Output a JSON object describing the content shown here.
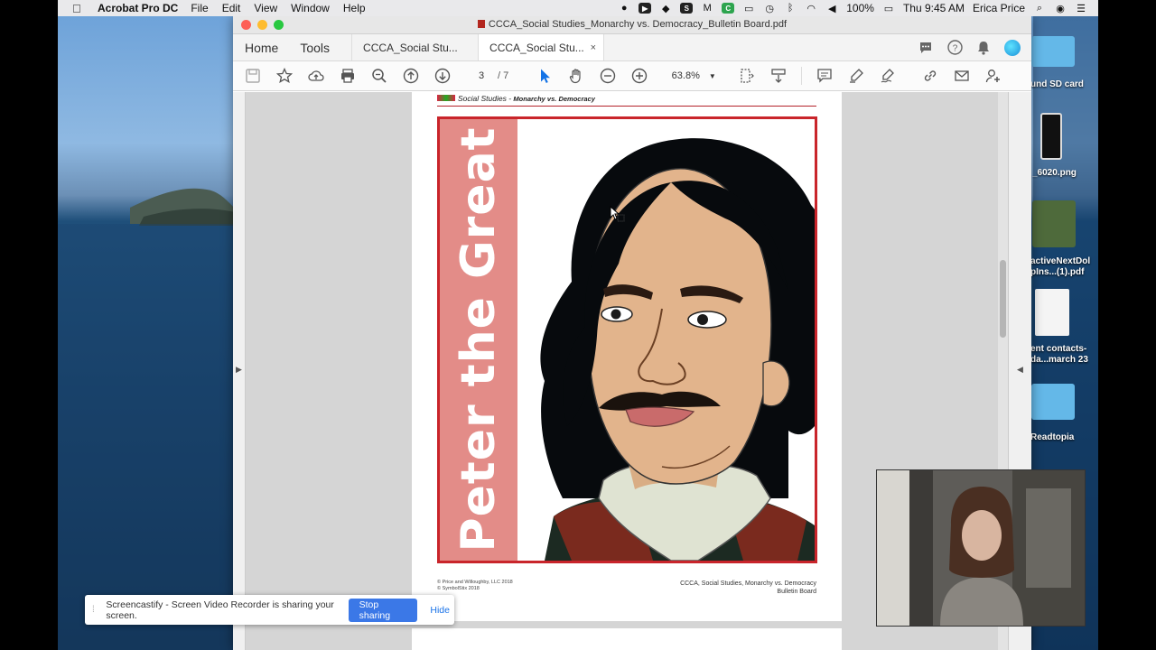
{
  "menubar": {
    "app_name": "Acrobat Pro DC",
    "menus": [
      "File",
      "Edit",
      "View",
      "Window",
      "Help"
    ],
    "battery": "100%",
    "clock": "Thu 9:45 AM",
    "user": "Erica Price"
  },
  "window": {
    "title": "CCCA_Social Studies_Monarchy vs. Democracy_Bulletin Board.pdf"
  },
  "tabs": {
    "home": "Home",
    "tools": "Tools",
    "doc_tab_1": "CCCA_Social Stu...",
    "doc_tab_2": "CCCA_Social Stu...",
    "close": "×"
  },
  "toolbar": {
    "page_current": "3",
    "page_total": "/ 7",
    "zoom": "63.8%"
  },
  "document": {
    "header_subject": "Social Studies - ",
    "header_topic": "Monarchy vs. Democracy",
    "poster_title": "Peter the Great",
    "footer_left_1": "© Price and Willoughby, LLC 2018",
    "footer_left_2": "© SymbolStix 2018",
    "footer_right_1": "CCCA, Social Studies, Monarchy vs. Democracy",
    "footer_right_2": "Bulletin Board"
  },
  "desktop_items": [
    {
      "label": "und SD card"
    },
    {
      "label": "_6020.png"
    },
    {
      "label": "activeNextDol"
    },
    {
      "label": "pIns...(1).pdf"
    },
    {
      "label": "ent contacts-"
    },
    {
      "label": "da...march 23"
    },
    {
      "label": "Readtopia"
    }
  ],
  "screencastify": {
    "message": "Screencastify - Screen Video Recorder is sharing your screen.",
    "stop_label": "Stop sharing",
    "hide_label": "Hide"
  },
  "icons": {
    "save": "save-icon",
    "star": "star-icon",
    "upload": "cloud-upload-icon",
    "print": "print-icon",
    "zoom_search": "zoom-search-icon",
    "prev_page": "arrow-up-circle-icon",
    "next_page": "arrow-down-circle-icon",
    "select": "cursor-icon",
    "hand": "hand-icon",
    "zoom_out": "zoom-out-icon",
    "zoom_in": "zoom-in-icon"
  },
  "colors": {
    "poster_border": "#c9252b",
    "poster_band": "#e38c88",
    "stop_button": "#3b78e7"
  }
}
